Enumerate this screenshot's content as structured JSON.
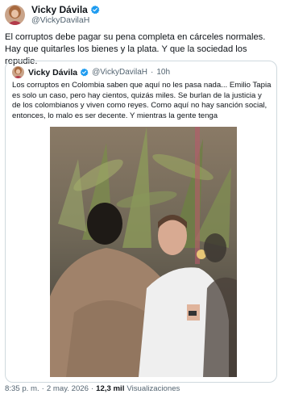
{
  "tweet": {
    "author_name": "Vicky Dávila",
    "author_handle": "@VickyDavilaH",
    "text": "El corruptos debe pagar su pena completa en cárceles normales. Hay que quitarles los bienes y la plata. Y que la sociedad los repudie.",
    "time": "8:35 p. m.",
    "separator": "·",
    "date": "2 may. 2026",
    "views_count": "12,3 mil",
    "views_label": "Visualizaciones"
  },
  "quoted": {
    "author_name": "Vicky Dávila",
    "author_handle": "@VickyDavilaH",
    "separator": "·",
    "time_ago": "10h",
    "text": "Los corruptos en Colombia saben que aquí no les pasa nada... Emilio Tapia es solo un caso, pero hay cientos, quizás miles. Se burlan de la justicia y de los colombianos y viven como reyes. Como aquí no hay sanción social, entonces, lo malo es ser decente. Y mientras la gente tenga"
  },
  "icons": {
    "verified": "verified-badge-icon"
  },
  "colors": {
    "verified": "#1d9bf0",
    "text_primary": "#0f1419",
    "text_secondary": "#536471",
    "border": "#cfd9de"
  }
}
